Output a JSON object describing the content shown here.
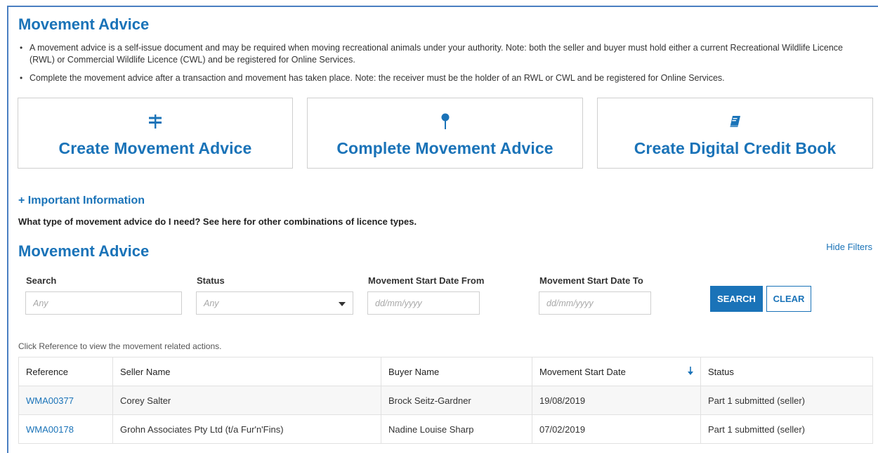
{
  "page": {
    "title": "Movement Advice",
    "bullets": [
      "A movement advice is a self-issue document and may be required when moving recreational animals under your authority. Note: both the seller and buyer must hold either a current Recreational Wildlife Licence (RWL) or Commercial Wildlife Licence (CWL) and be registered for Online Services.",
      "Complete the movement advice after a transaction and movement has taken place. Note: the receiver must be the holder of an RWL or CWL and be registered for Online Services."
    ]
  },
  "cards": [
    {
      "label": "Create Movement Advice",
      "icon": "signpost-icon"
    },
    {
      "label": "Complete Movement Advice",
      "icon": "map-pin-icon"
    },
    {
      "label": "Create Digital Credit Book",
      "icon": "book-icon"
    }
  ],
  "info": {
    "important": "+ Important Information",
    "what_type": "What type of movement advice do I need? See here for other combinations of licence types."
  },
  "filters": {
    "section_title": "Movement Advice",
    "hide_label": "Hide Filters",
    "search_label": "Search",
    "search_placeholder": "Any",
    "status_label": "Status",
    "status_value": "Any",
    "from_label": "Movement Start Date From",
    "from_placeholder": "dd/mm/yyyy",
    "to_label": "Movement Start Date To",
    "to_placeholder": "dd/mm/yyyy",
    "search_button": "SEARCH",
    "clear_button": "CLEAR"
  },
  "table": {
    "note": "Click Reference to view the movement related actions.",
    "headers": {
      "reference": "Reference",
      "seller": "Seller Name",
      "buyer": "Buyer Name",
      "date": "Movement Start Date",
      "status": "Status"
    },
    "rows": [
      {
        "reference": "WMA00377",
        "seller": "Corey Salter",
        "buyer": "Brock Seitz-Gardner",
        "date": "19/08/2019",
        "status": "Part 1 submitted (seller)"
      },
      {
        "reference": "WMA00178",
        "seller": "Grohn Associates Pty Ltd (t/a Fur'n'Fins)",
        "buyer": "Nadine Louise Sharp",
        "date": "07/02/2019",
        "status": "Part 1 submitted (seller)"
      }
    ]
  },
  "colors": {
    "primary": "#1a73b8",
    "frame": "#4a7fc1"
  }
}
